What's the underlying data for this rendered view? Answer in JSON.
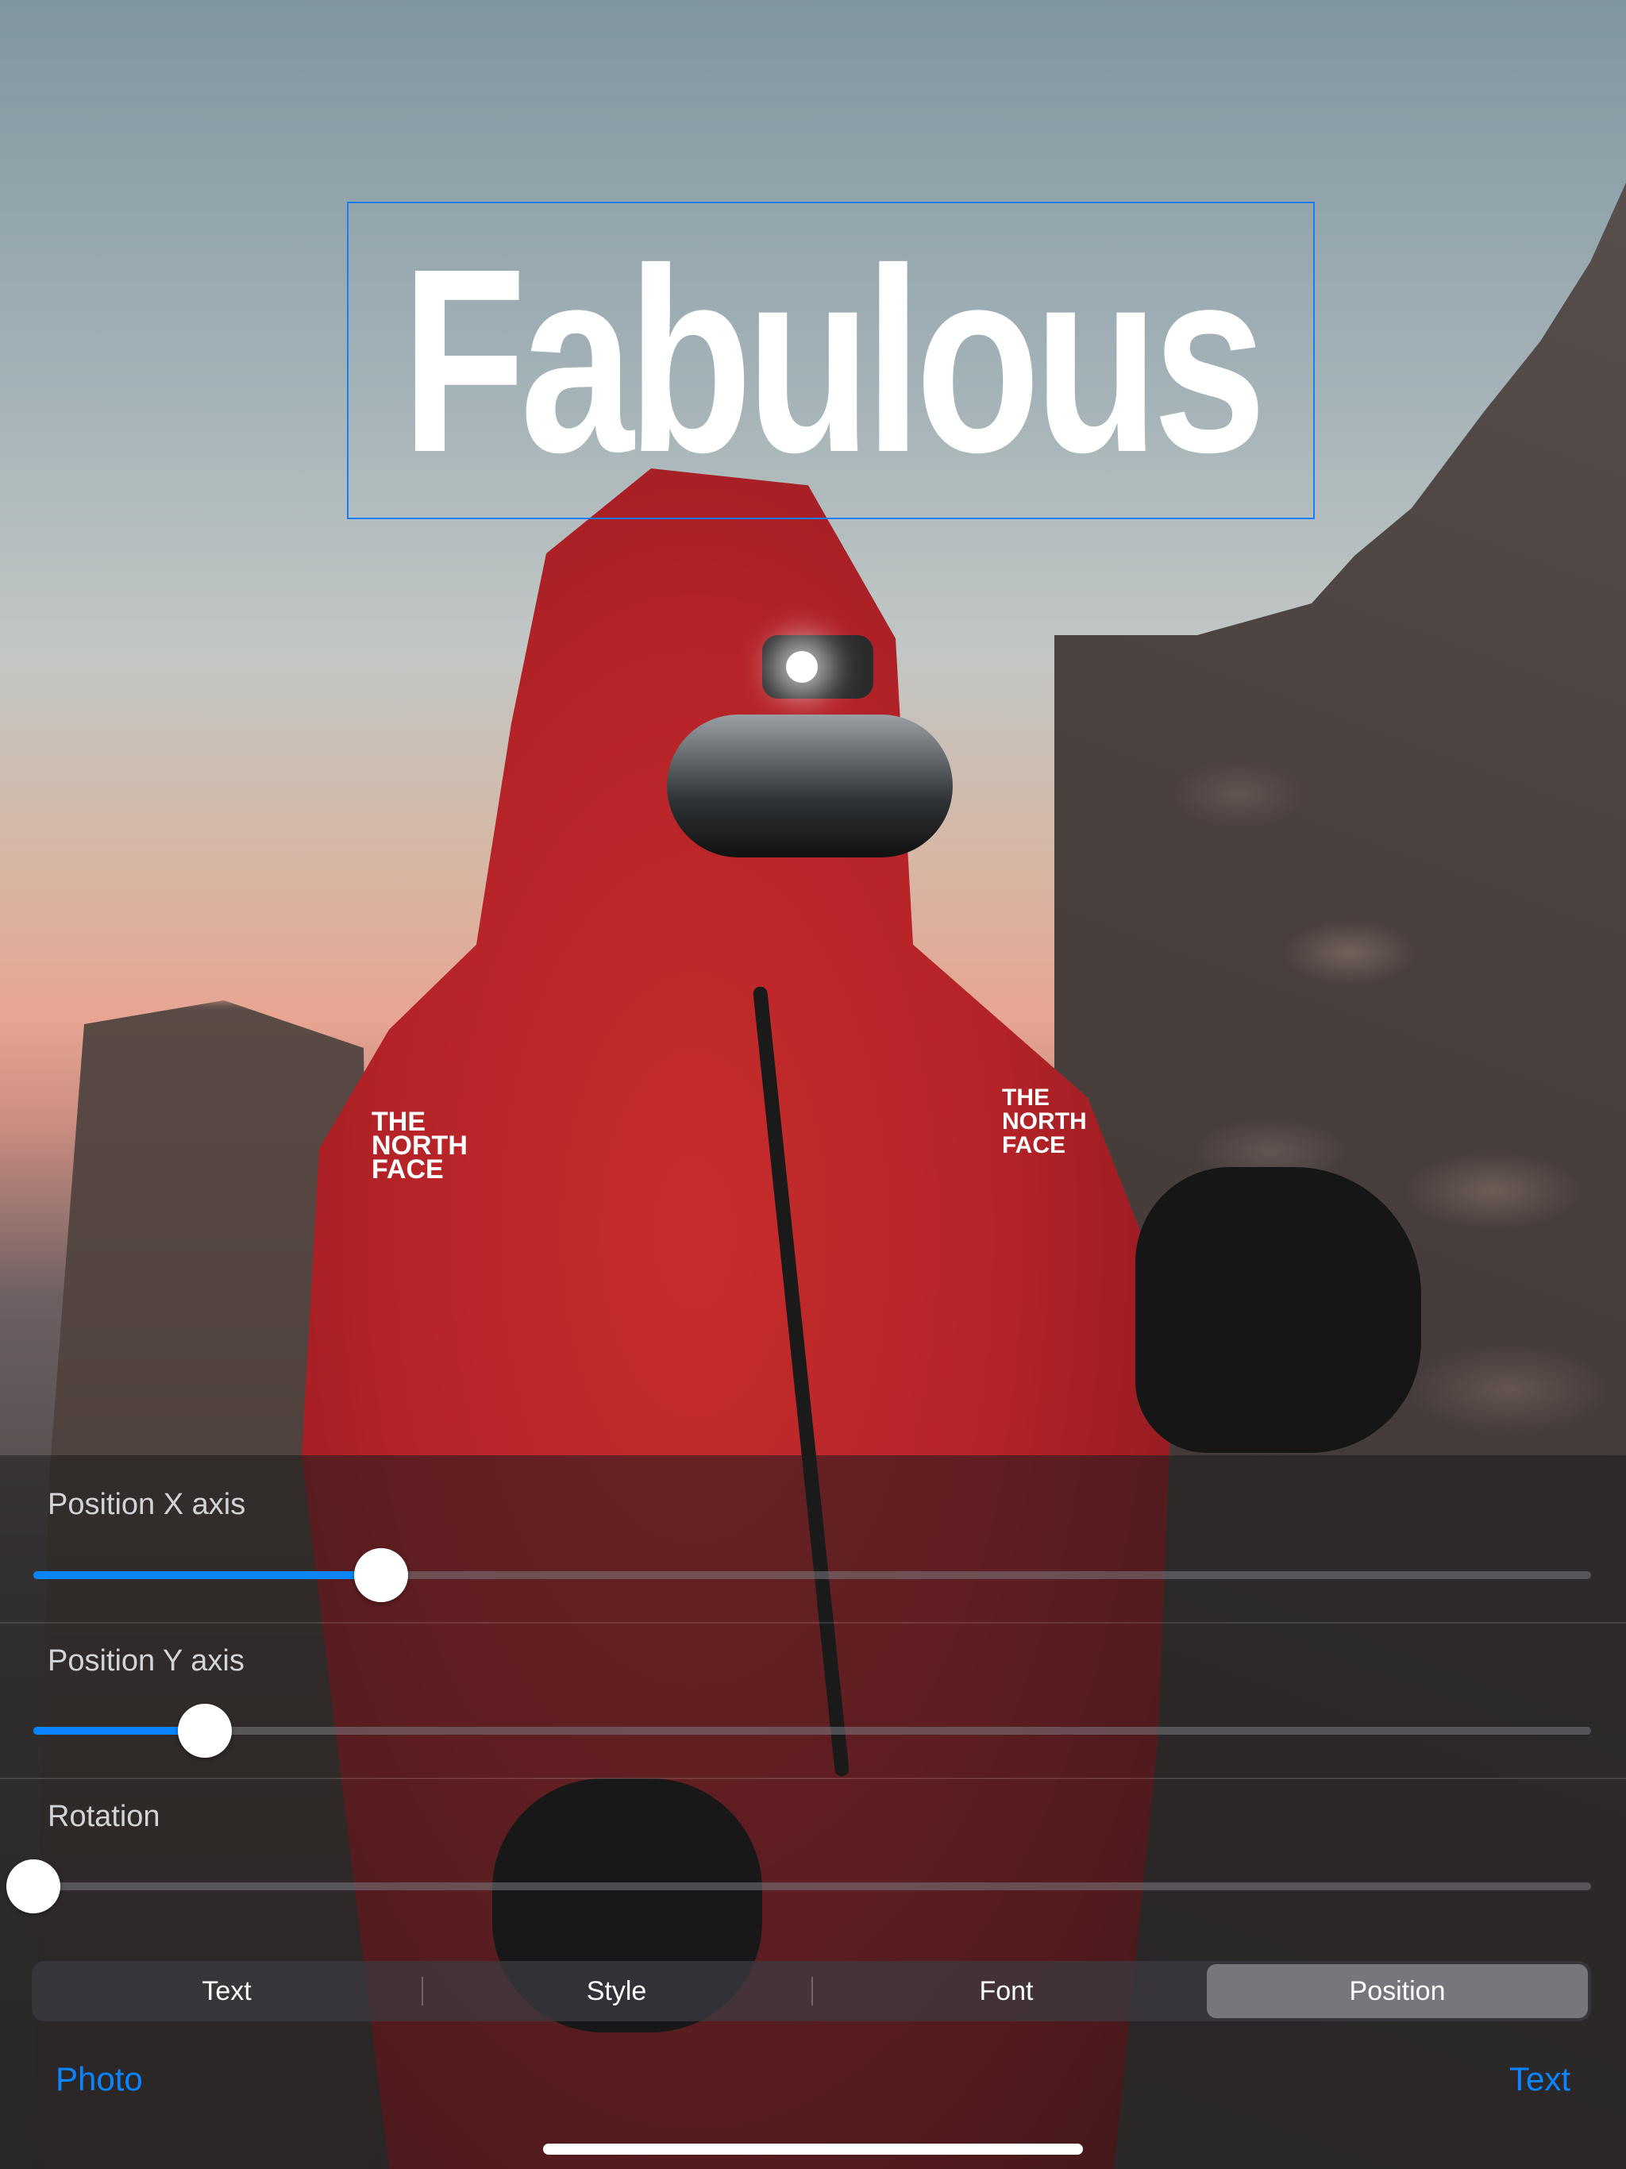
{
  "overlay_text": {
    "headline": "Fabulous"
  },
  "jacket_logo": "THE NORTH FACE",
  "sliders": [
    {
      "label": "Position X axis",
      "value": 0.223
    },
    {
      "label": "Position Y axis",
      "value": 0.11
    },
    {
      "label": "Rotation",
      "value": 0.0
    }
  ],
  "tabs": {
    "items": [
      "Text",
      "Style",
      "Font",
      "Position"
    ],
    "selected": "Position"
  },
  "bottom_bar": {
    "left_link": "Photo",
    "right_link": "Text"
  },
  "colors": {
    "accent": "#0a84ff",
    "selection_border": "#1a7df0",
    "track": "#6e6e76",
    "active_tab": "#76767c"
  }
}
